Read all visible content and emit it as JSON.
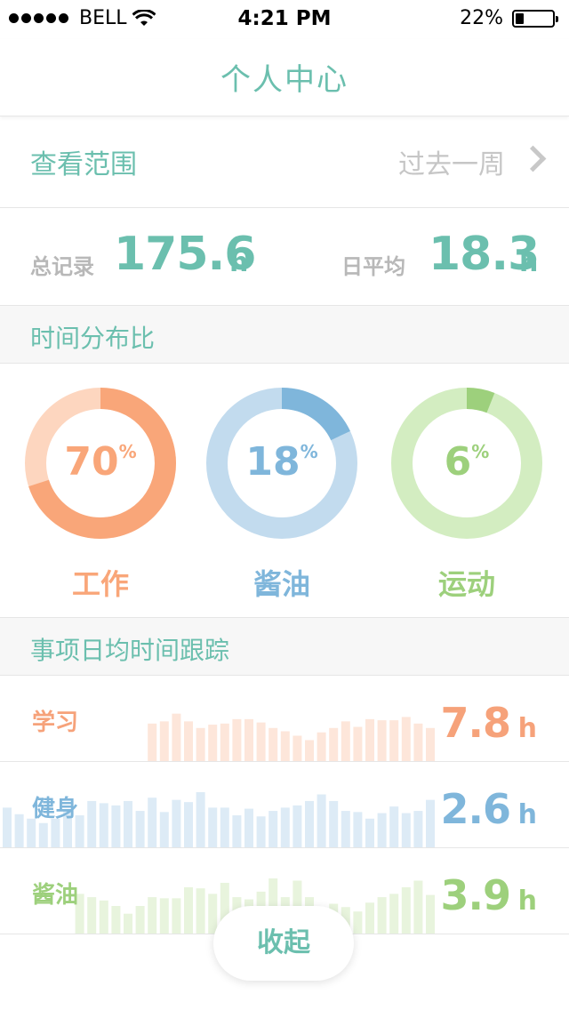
{
  "status_bar": {
    "carrier": "BELL",
    "time": "4:21 PM",
    "battery": "22%",
    "battery_level": 0.22
  },
  "nav": {
    "title": "个人中心"
  },
  "range": {
    "label": "查看范围",
    "value": "过去一周"
  },
  "totals": {
    "total_label": "总记录",
    "total_value": "175.6",
    "total_unit": "h",
    "avg_label": "日平均",
    "avg_value": "18.3",
    "avg_unit": "h"
  },
  "distribution": {
    "title": "时间分布比",
    "items": [
      {
        "name": "工作",
        "percent": 70,
        "percent_label": "70",
        "color": "#f9a679",
        "track": "#fdd6bf"
      },
      {
        "name": "酱油",
        "percent": 18,
        "percent_label": "18",
        "color": "#7fb6db",
        "track": "#c2dbee"
      },
      {
        "name": "运动",
        "percent": 6,
        "percent_label": "6",
        "color": "#9dd07c",
        "track": "#d3edc1"
      }
    ],
    "pct_symbol": "%"
  },
  "tracking": {
    "title": "事项日均时间跟踪",
    "items": [
      {
        "name": "学习",
        "value": "7.8",
        "unit": "h",
        "color": "#f6a27a",
        "bar_color": "#fde6da",
        "bars": [
          0,
          0,
          0,
          0,
          0,
          0,
          0,
          0,
          0,
          0,
          0,
          0,
          0.68,
          0.72,
          0.86,
          0.72,
          0.6,
          0.66,
          0.68,
          0.76,
          0.76,
          0.7,
          0.6,
          0.54,
          0.46,
          0.38,
          0.52,
          0.6,
          0.72,
          0.62,
          0.76,
          0.74,
          0.74,
          0.8,
          0.68,
          0.6
        ]
      },
      {
        "name": "健身",
        "value": "2.6",
        "unit": "h",
        "color": "#7fb6db",
        "bar_color": "#ddebf6",
        "bars": [
          0.72,
          0.6,
          0.52,
          0.44,
          0.52,
          0.66,
          0.58,
          0.84,
          0.8,
          0.76,
          0.84,
          0.66,
          0.9,
          0.64,
          0.86,
          0.82,
          1.0,
          0.72,
          0.72,
          0.58,
          0.7,
          0.56,
          0.66,
          0.72,
          0.76,
          0.84,
          0.96,
          0.84,
          0.66,
          0.64,
          0.52,
          0.62,
          0.74,
          0.62,
          0.66,
          0.86
        ]
      },
      {
        "name": "酱油",
        "value": "3.9",
        "unit": "h",
        "color": "#9dd07c",
        "bar_color": "#e8f4dd",
        "bars": [
          0,
          0,
          0,
          0,
          0,
          0,
          0.72,
          0.66,
          0.6,
          0.5,
          0.36,
          0.5,
          0.66,
          0.64,
          0.64,
          0.84,
          0.82,
          0.72,
          0.92,
          0.66,
          0.62,
          0.76,
          1.0,
          0.66,
          0.96,
          0.66,
          0.4,
          0.54,
          0.48,
          0.4,
          0.56,
          0.66,
          0.72,
          0.84,
          0.96,
          0.7
        ]
      }
    ]
  },
  "footer": {
    "collapse_label": "收起"
  }
}
